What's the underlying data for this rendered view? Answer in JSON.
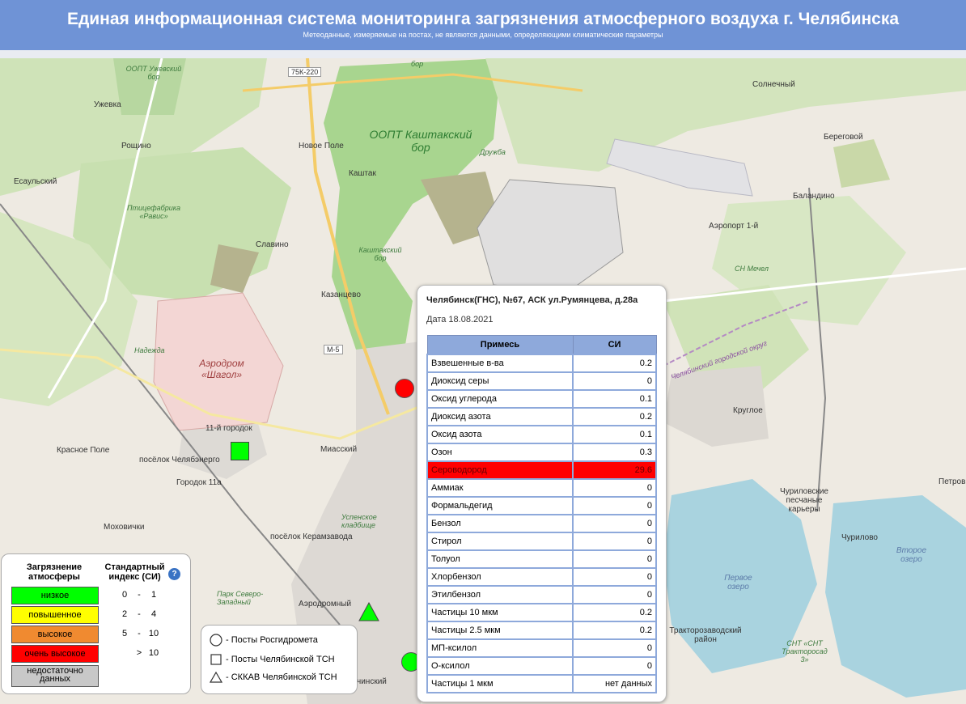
{
  "header": {
    "title": "Единая информационная система мониторинга загрязнения атмосферного воздуха г. Челябинска",
    "subtitle": "Метеоданные, измеряемые на постах, не являются данными, определяющими климатические параметры"
  },
  "map": {
    "labels": {
      "uzhevsky_bor": "ООПТ Ужевский бор",
      "uzhevka": "Ужевка",
      "roschino": "Рощино",
      "esaulsky": "Есаульский",
      "ptitsefabrika": "Птицефабрика «Равис»",
      "slavino": "Славино",
      "kazantsevo": "Казанцево",
      "nadezhda": "Надежда",
      "aerodrom_shagol": "Аэродром «Шагол»",
      "gorodok11": "11-й городок",
      "krasnoe_pole": "Красное Поле",
      "chelyabenergo": "посёлок Челябэнерго",
      "gorodok11a": "Городок 11а",
      "miassky": "Миасский",
      "mokhovichki": "Моховички",
      "keramzavod": "посёлок Керамзавода",
      "uspenskoe": "Успенское кладбище",
      "park": "Парк Северо-Западный",
      "aerodromny": "Аэродромный",
      "kashtaksky_bor": "ООПТ Каштакский бор",
      "kashtaksky_bor2": "Каштакский бор",
      "novoe_pole": "Новое Поле",
      "kashtak": "Каштак",
      "druzhba": "Дружба",
      "road_75k": "75К-220",
      "road_m5": "М-5",
      "bor_top": "бор",
      "solnechny": "Солнечный",
      "beregovoy": "Береговой",
      "balandino": "Баландино",
      "airport1": "Аэропорт 1-й",
      "sn_mechel": "СН Мечел",
      "ring": "Челябинский городской округ",
      "krugloe": "Круглое",
      "karery": "Чуриловские песчаные карьеры",
      "petrov": "Петров",
      "churilovo": "Чурилово",
      "lake1": "Первое озеро",
      "lake2": "Второе озеро",
      "traktor": "Тракторозаводский район",
      "snt": "СНТ «СНТ Трактороса­д 3»",
      "chinsky": "чинский"
    }
  },
  "popup": {
    "title": "Челябинск(ГНС), №67, АСК ул.Румянцева, д.28а",
    "date": "Дата 18.08.2021",
    "columns": [
      "Примесь",
      "СИ"
    ],
    "rows": [
      {
        "name": "Взвешенные в-ва",
        "value": "0.2"
      },
      {
        "name": "Диоксид серы",
        "value": "0"
      },
      {
        "name": "Оксид углерода",
        "value": "0.1"
      },
      {
        "name": "Диоксид азота",
        "value": "0.2"
      },
      {
        "name": "Оксид азота",
        "value": "0.1"
      },
      {
        "name": "Озон",
        "value": "0.3"
      },
      {
        "name": "Сероводород",
        "value": "29.6"
      },
      {
        "name": "Аммиак",
        "value": "0"
      },
      {
        "name": "Формальдегид",
        "value": "0"
      },
      {
        "name": "Бензол",
        "value": "0"
      },
      {
        "name": "Стирол",
        "value": "0"
      },
      {
        "name": "Толуол",
        "value": "0"
      },
      {
        "name": "Хлорбензол",
        "value": "0"
      },
      {
        "name": "Этилбензол",
        "value": "0"
      },
      {
        "name": "Частицы 10 мкм",
        "value": "0.2"
      },
      {
        "name": "Частицы 2.5 мкм",
        "value": "0.2"
      },
      {
        "name": "МП-ксилол",
        "value": "0"
      },
      {
        "name": "О-ксилол",
        "value": "0"
      },
      {
        "name": "Частицы 1 мкм",
        "value": "нет данных"
      }
    ],
    "alarm_color": "#ff0000"
  },
  "legend": {
    "heading1": "Загрязнение атмосферы",
    "heading2": "Стандартный индекс (СИ)",
    "help": "?",
    "levels": [
      {
        "label": "низкое",
        "color": "#00ff00",
        "from": "0",
        "sep": "-",
        "to": "1"
      },
      {
        "label": "повышенное",
        "color": "#ffff00",
        "from": "2",
        "sep": "-",
        "to": "4"
      },
      {
        "label": "высокое",
        "color": "#f08a30",
        "from": "5",
        "sep": "-",
        "to": "10"
      },
      {
        "label": "очень высокое",
        "color": "#ff0000",
        "from": "",
        "sep": ">",
        "to": "10"
      },
      {
        "label": "недостаточно данных",
        "color": "#c8c8c8",
        "from": "",
        "sep": "",
        "to": ""
      }
    ]
  },
  "stations_legend": [
    {
      "shape": "circle",
      "label": "- Посты Росгидромета"
    },
    {
      "shape": "square",
      "label": "- Посты Челябинской ТСН"
    },
    {
      "shape": "triangle",
      "label": "- СККАВ Челябинской ТСН"
    }
  ],
  "markers": [
    {
      "shape": "circle",
      "color": "#ff0000"
    },
    {
      "shape": "square",
      "color": "#00ff00"
    },
    {
      "shape": "triangle",
      "color": "#00ff00"
    },
    {
      "shape": "circle",
      "color": "#00ff00"
    }
  ]
}
